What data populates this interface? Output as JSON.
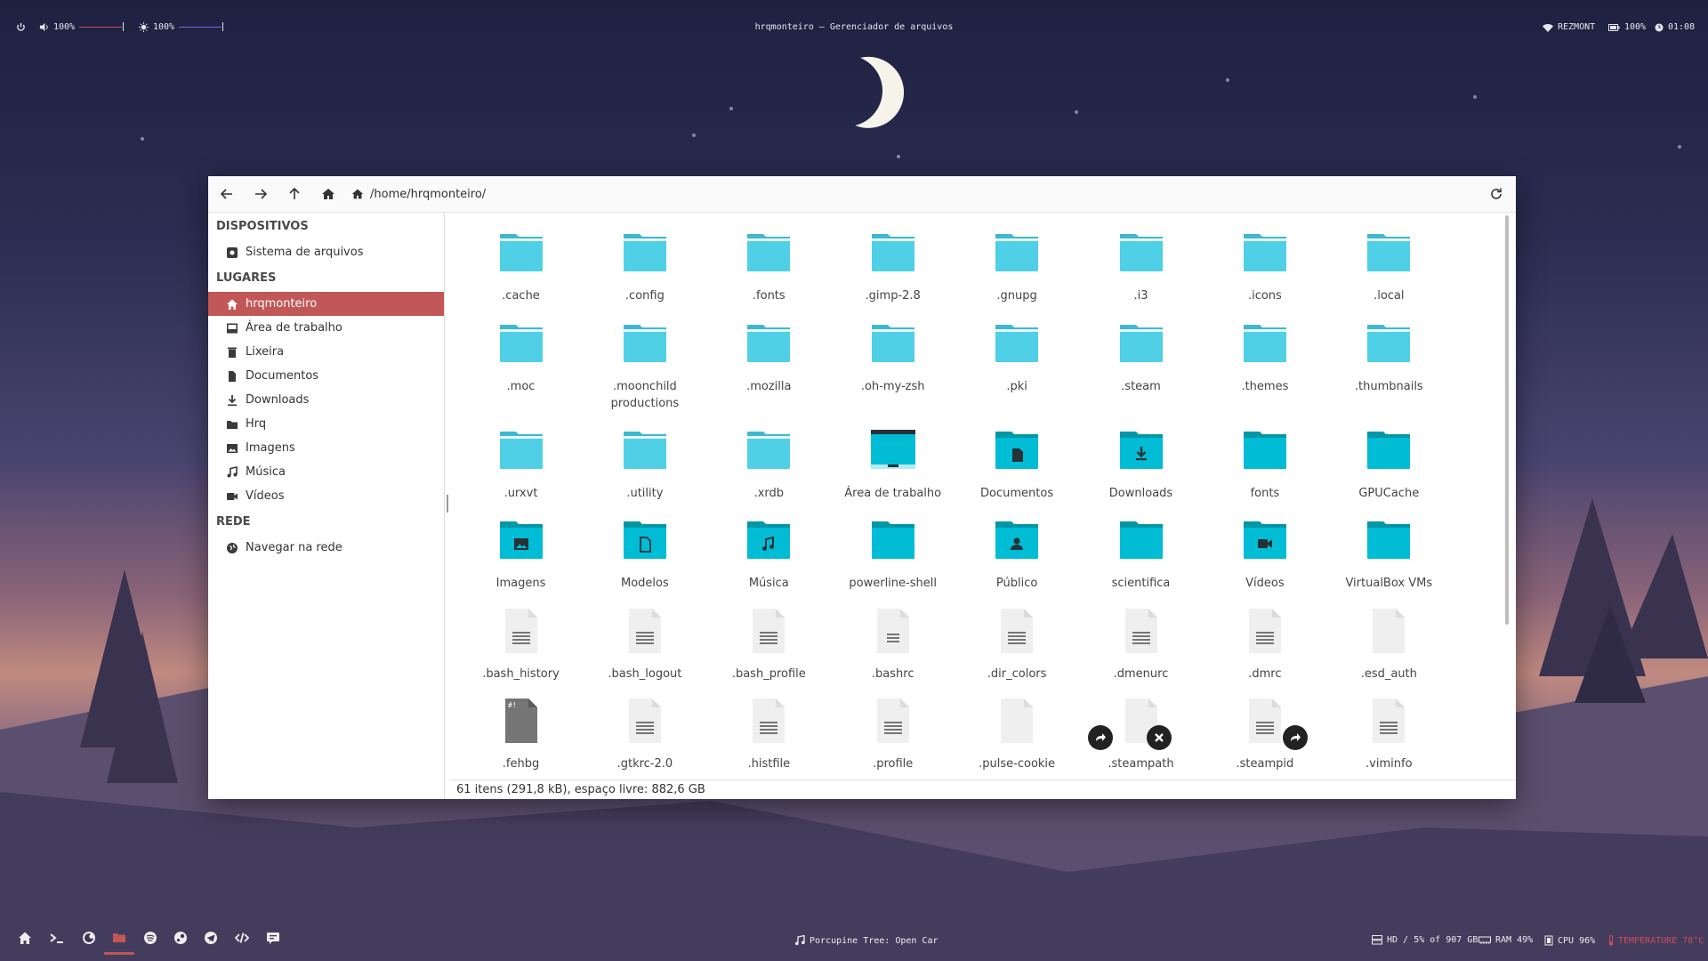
{
  "topbar": {
    "volume": "100%",
    "brightness": "100%",
    "window_title": "hrqmonteiro – Gerenciador de arquivos",
    "wifi": "REZMONT",
    "battery": "100%",
    "clock": "01:08",
    "accent_volume": "#d24a5a",
    "accent_brightness": "#6a6ae0"
  },
  "toolbar": {
    "back_icon": "arrow-left-icon",
    "forward_icon": "arrow-right-icon",
    "up_icon": "arrow-up-icon",
    "home_icon": "home-icon",
    "path": "/home/hrqmonteiro/",
    "reload_icon": "reload-icon"
  },
  "sidebar": {
    "sections": [
      {
        "title": "DISPOSITIVOS",
        "items": [
          {
            "label": "Sistema de arquivos",
            "icon": "drive-icon"
          }
        ]
      },
      {
        "title": "LUGARES",
        "items": [
          {
            "label": "hrqmonteiro",
            "icon": "home-icon",
            "active": true
          },
          {
            "label": "Área de trabalho",
            "icon": "desktop-icon"
          },
          {
            "label": "Lixeira",
            "icon": "trash-icon"
          },
          {
            "label": "Documentos",
            "icon": "document-icon"
          },
          {
            "label": "Downloads",
            "icon": "download-icon"
          },
          {
            "label": "Hrq",
            "icon": "folder-icon"
          },
          {
            "label": "Imagens",
            "icon": "image-icon"
          },
          {
            "label": "Música",
            "icon": "music-icon"
          },
          {
            "label": "Vídeos",
            "icon": "video-icon"
          }
        ]
      },
      {
        "title": "REDE",
        "items": [
          {
            "label": "Navegar na rede",
            "icon": "globe-icon"
          }
        ]
      }
    ],
    "active_color": "#c25757"
  },
  "files": [
    {
      "name": ".cache",
      "kind": "folder-light"
    },
    {
      "name": ".config",
      "kind": "folder-light"
    },
    {
      "name": ".fonts",
      "kind": "folder-light"
    },
    {
      "name": ".gimp-2.8",
      "kind": "folder-light"
    },
    {
      "name": ".gnupg",
      "kind": "folder-light"
    },
    {
      "name": ".i3",
      "kind": "folder-light"
    },
    {
      "name": ".icons",
      "kind": "folder-light"
    },
    {
      "name": ".local",
      "kind": "folder-light"
    },
    {
      "name": ".moc",
      "kind": "folder-light"
    },
    {
      "name": ".moonchild productions",
      "kind": "folder-light"
    },
    {
      "name": ".mozilla",
      "kind": "folder-light"
    },
    {
      "name": ".oh-my-zsh",
      "kind": "folder-light"
    },
    {
      "name": ".pki",
      "kind": "folder-light"
    },
    {
      "name": ".steam",
      "kind": "folder-light"
    },
    {
      "name": ".themes",
      "kind": "folder-light"
    },
    {
      "name": ".thumbnails",
      "kind": "folder-light"
    },
    {
      "name": ".urxvt",
      "kind": "folder-light"
    },
    {
      "name": ".utility",
      "kind": "folder-light"
    },
    {
      "name": ".xrdb",
      "kind": "folder-light"
    },
    {
      "name": "Área de trabalho",
      "kind": "desktop"
    },
    {
      "name": "Documentos",
      "kind": "folder",
      "glyph": "doc"
    },
    {
      "name": "Downloads",
      "kind": "folder",
      "glyph": "download"
    },
    {
      "name": "fonts",
      "kind": "folder"
    },
    {
      "name": "GPUCache",
      "kind": "folder"
    },
    {
      "name": "Imagens",
      "kind": "folder",
      "glyph": "image"
    },
    {
      "name": "Modelos",
      "kind": "folder",
      "glyph": "template"
    },
    {
      "name": "Música",
      "kind": "folder",
      "glyph": "music"
    },
    {
      "name": "powerline-shell",
      "kind": "folder"
    },
    {
      "name": "Público",
      "kind": "folder",
      "glyph": "user"
    },
    {
      "name": "scientifica",
      "kind": "folder"
    },
    {
      "name": "Vídeos",
      "kind": "folder",
      "glyph": "video"
    },
    {
      "name": "VirtualBox VMs",
      "kind": "folder"
    },
    {
      "name": ".bash_history",
      "kind": "text"
    },
    {
      "name": ".bash_logout",
      "kind": "text"
    },
    {
      "name": ".bash_profile",
      "kind": "text"
    },
    {
      "name": ".bashrc",
      "kind": "text-small"
    },
    {
      "name": ".dir_colors",
      "kind": "text"
    },
    {
      "name": ".dmenurc",
      "kind": "text"
    },
    {
      "name": ".dmrc",
      "kind": "text"
    },
    {
      "name": ".esd_auth",
      "kind": "blank"
    },
    {
      "name": ".fehbg",
      "kind": "script"
    },
    {
      "name": ".gtkrc-2.0",
      "kind": "text"
    },
    {
      "name": ".histfile",
      "kind": "text"
    },
    {
      "name": ".profile",
      "kind": "text"
    },
    {
      "name": ".pulse-cookie",
      "kind": "blank"
    },
    {
      "name": ".steampath",
      "kind": "blank",
      "emblems": [
        "link",
        "broken"
      ]
    },
    {
      "name": ".steampid",
      "kind": "text",
      "emblems": [
        "link"
      ]
    },
    {
      "name": ".viminfo",
      "kind": "text"
    }
  ],
  "statusbar": {
    "text": "61 itens (291,8 kB), espaço livre: 882,6 GB"
  },
  "bottombar": {
    "launchers": [
      "home-icon",
      "terminal-icon",
      "firefox-icon",
      "folder-icon",
      "spotify-icon",
      "steam-icon",
      "telegram-icon",
      "code-icon",
      "chat-icon"
    ],
    "active_launcher": 3,
    "now_playing": "Porcupine Tree: Open Car",
    "disk": "HD / 5% of 907 GB",
    "ram": "RAM 49%",
    "cpu": "CPU 96%",
    "temperature": "TEMPERATURE 78°C",
    "temperature_color": "#d24a5a"
  },
  "colors": {
    "folder_light": "#4fd0e6",
    "folder_light_tab": "#3fb8cf",
    "folder": "#00bcd4",
    "folder_tab": "#0097a7",
    "desktop_folder_top": "#263238"
  }
}
